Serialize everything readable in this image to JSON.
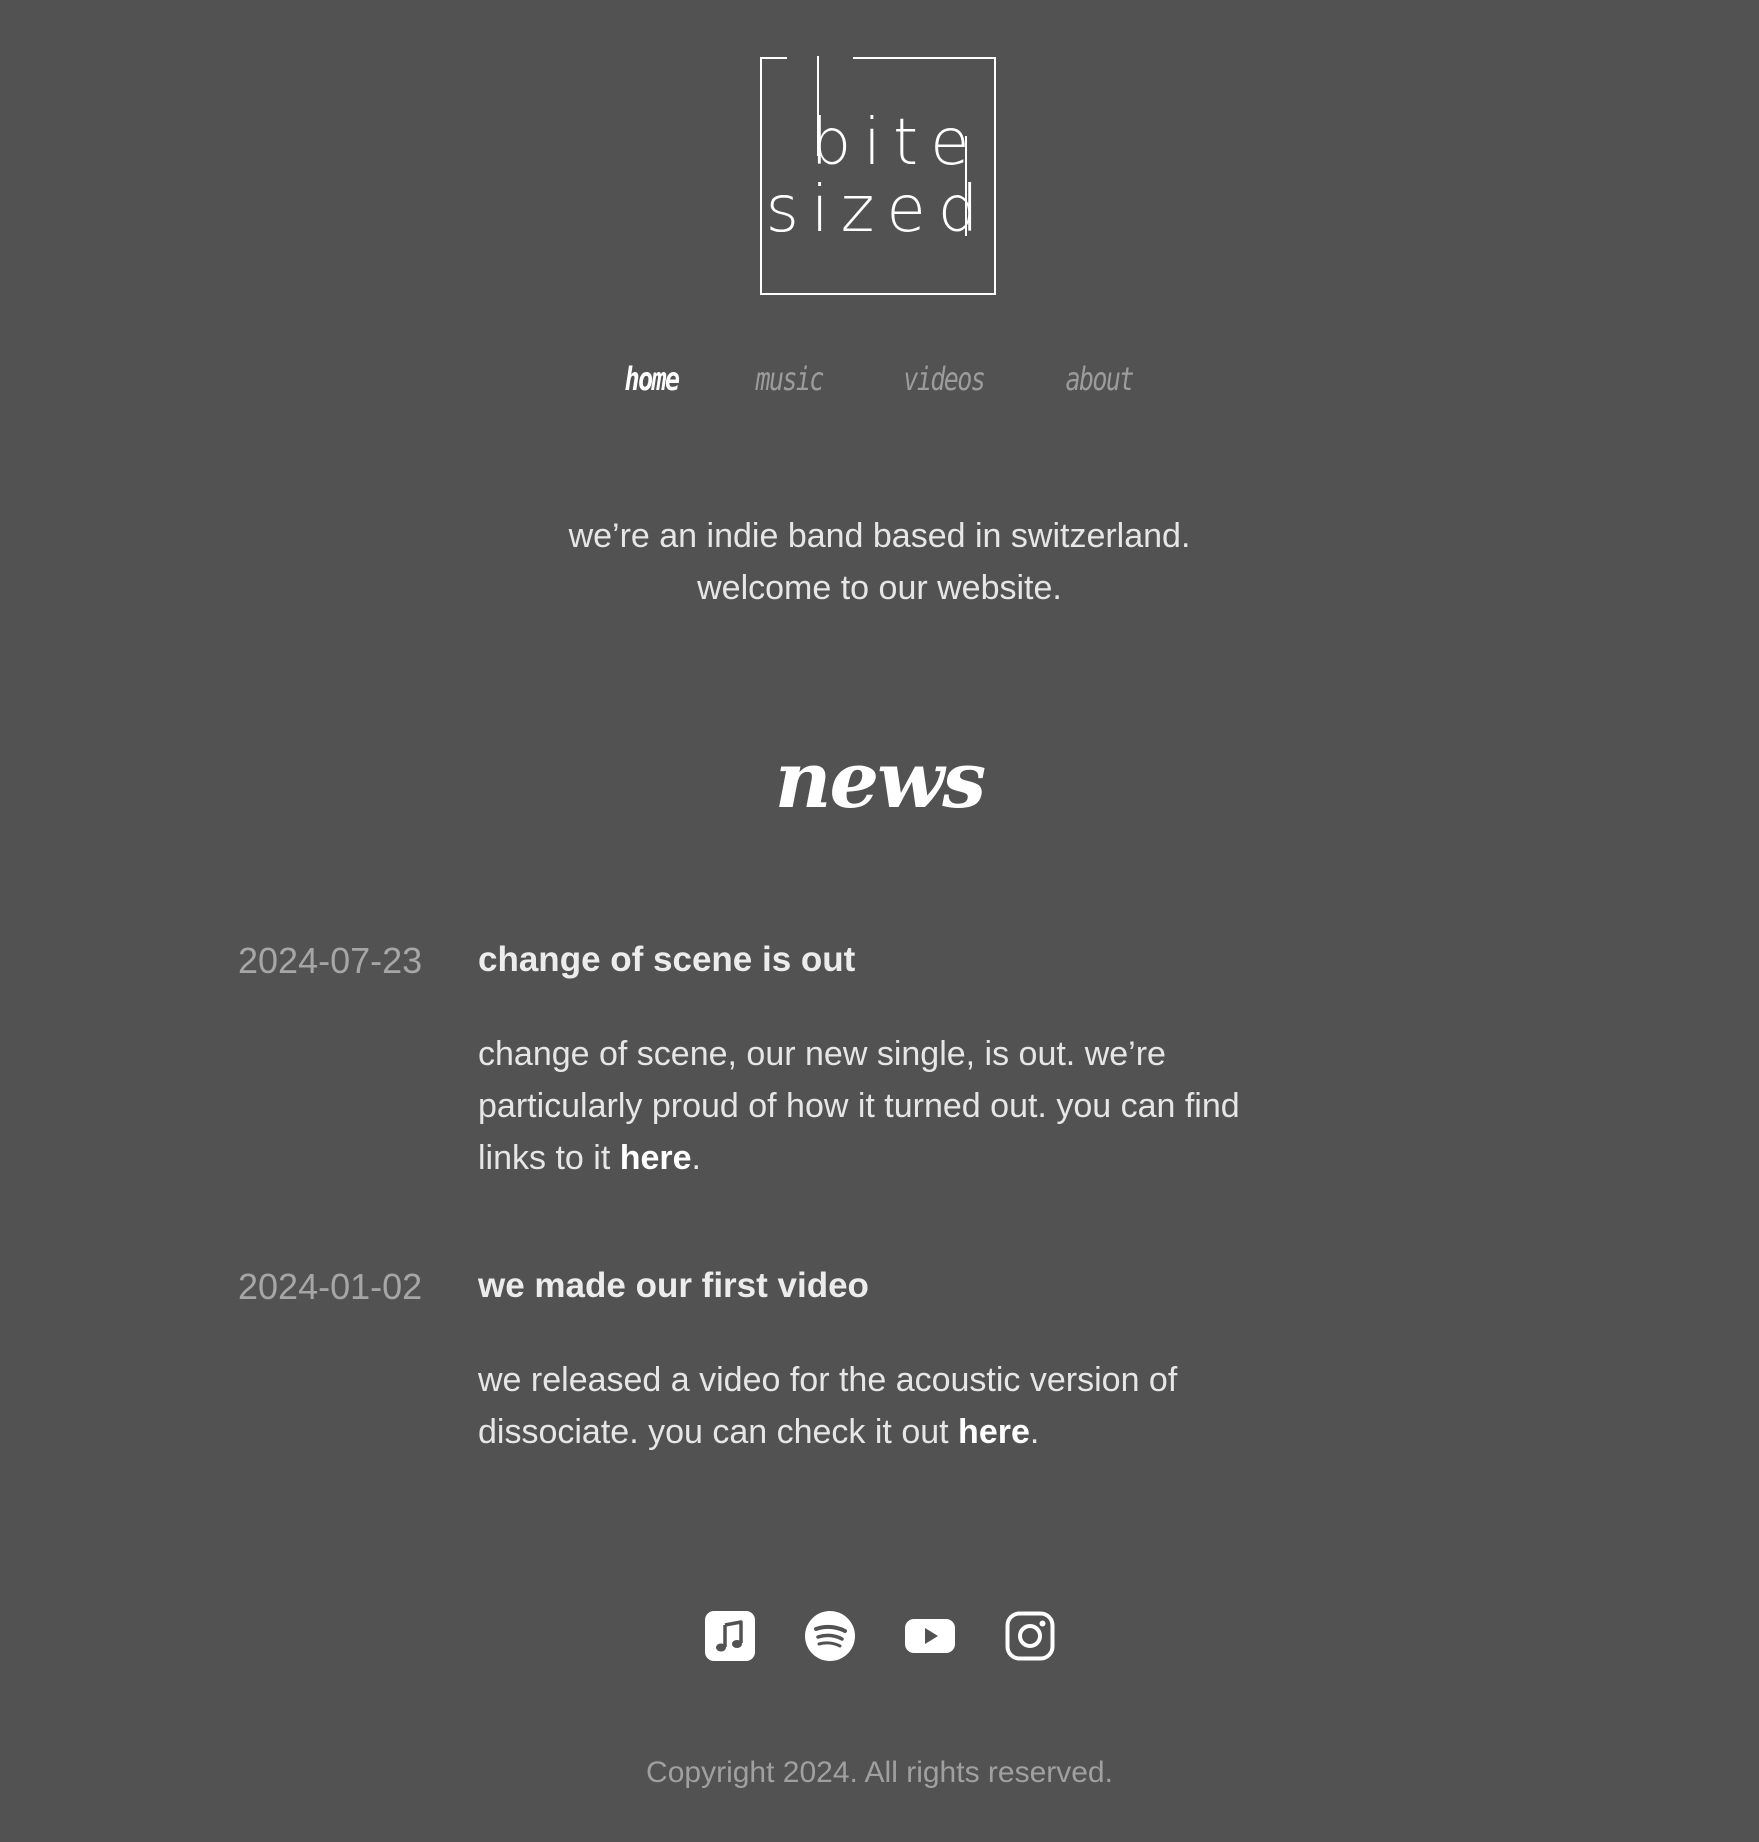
{
  "logo": {
    "line1": "bite",
    "line2": "sized"
  },
  "nav": {
    "items": [
      {
        "label": "home",
        "active": true
      },
      {
        "label": "music",
        "active": false
      },
      {
        "label": "videos",
        "active": false
      },
      {
        "label": "about",
        "active": false
      }
    ]
  },
  "intro": {
    "line1": "we’re an indie band based in switzerland.",
    "line2": "welcome to our website."
  },
  "news": {
    "heading": "news",
    "items": [
      {
        "date": "2024-07-23",
        "title": "change of scene is out",
        "body_before": "change of scene, our new single, is out. we’re particularly proud of how it turned out. you can find links to it ",
        "link_label": "here",
        "body_after": "."
      },
      {
        "date": "2024-01-02",
        "title": "we made our first video",
        "body_before": "we released a video for the acoustic version of dissociate. you can check it out ",
        "link_label": "here",
        "body_after": "."
      }
    ]
  },
  "social": {
    "icons": [
      "apple-music-icon",
      "spotify-icon",
      "youtube-icon",
      "instagram-icon"
    ]
  },
  "footer": {
    "copyright": "Copyright 2024. All rights reserved."
  },
  "colors": {
    "background": "#525252",
    "text": "#e6e6e6",
    "muted": "#a6a6a6",
    "accent": "#ffffff"
  }
}
